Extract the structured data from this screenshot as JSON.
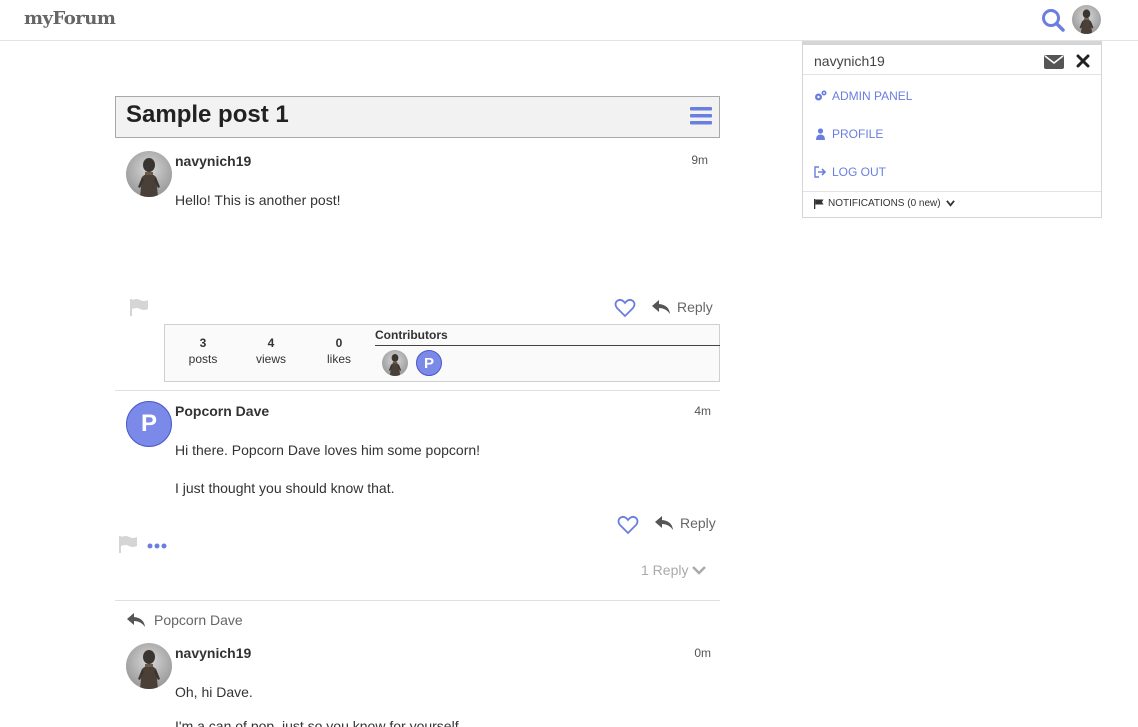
{
  "header": {
    "logo": "myForum",
    "search_icon": "search-icon",
    "avatar_icon": "user-avatar"
  },
  "topic": {
    "title": "Sample post 1",
    "menu_icon": "hamburger-icon"
  },
  "posts": [
    {
      "username": "navynich19",
      "time": "9m",
      "body": [
        "Hello!  This is another post!"
      ],
      "reply_label": "Reply"
    },
    {
      "username": "Popcorn Dave",
      "avatar_letter": "P",
      "time": "4m",
      "body": [
        "Hi there.  Popcorn Dave loves him some popcorn!",
        "I just thought you should know that."
      ],
      "reply_label": "Reply",
      "replies_toggle": "1 Reply"
    },
    {
      "reply_to": "Popcorn Dave",
      "username": "navynich19",
      "time": "0m",
      "body": [
        "Oh, hi Dave.",
        "I'm a can of pop, just so you know for yourself."
      ]
    }
  ],
  "topic_map": {
    "stats": [
      {
        "count": "3",
        "label": "posts"
      },
      {
        "count": "4",
        "label": "views"
      },
      {
        "count": "0",
        "label": "likes"
      }
    ],
    "contributors_label": "Contributors",
    "contributor_letter": "P"
  },
  "user_menu": {
    "username": "navynich19",
    "items": [
      {
        "label": "ADMIN PANEL",
        "icon": "gears-icon"
      },
      {
        "label": "PROFILE",
        "icon": "user-icon"
      },
      {
        "label": "LOG OUT",
        "icon": "sign-out-icon"
      }
    ],
    "notifications": "NOTIFICATIONS (0 new)"
  },
  "colors": {
    "accent": "#6a7ee0",
    "avatar_letter_bg": "#7b8ae8"
  }
}
